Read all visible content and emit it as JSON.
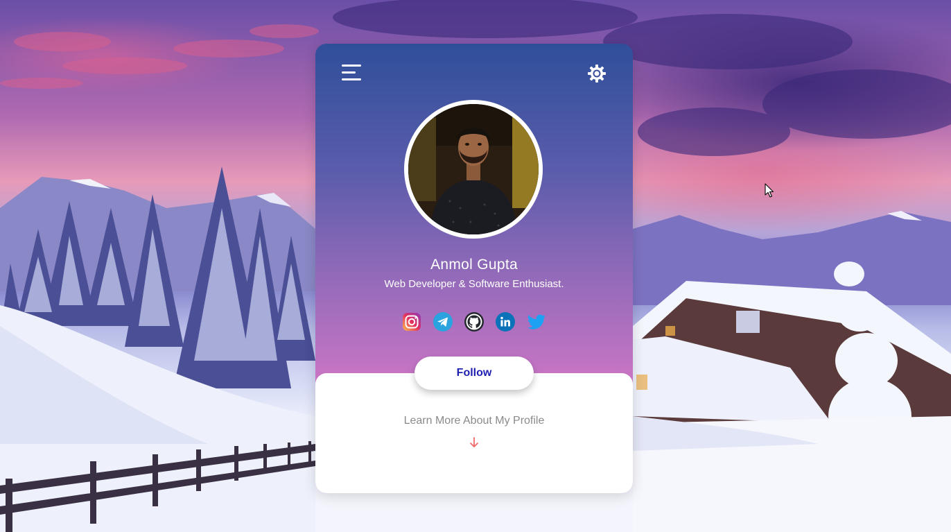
{
  "profile": {
    "name": "Anmol Gupta",
    "tagline": "Web Developer & Software Enthusiast."
  },
  "header": {
    "menu_icon": "hamburger-menu-icon",
    "settings_icon": "gear-icon"
  },
  "socials": [
    {
      "name": "instagram-icon",
      "color": "#e1306c"
    },
    {
      "name": "telegram-icon",
      "color": "#2aa3df"
    },
    {
      "name": "github-icon",
      "color": "#24292e"
    },
    {
      "name": "linkedin-icon",
      "color": "#0a66c2"
    },
    {
      "name": "twitter-icon",
      "color": "#1da1f2"
    }
  ],
  "actions": {
    "follow_label": "Follow",
    "learn_more_label": "Learn More About My Profile",
    "learn_more_icon": "arrow-down-icon"
  },
  "colors": {
    "follow_text": "#1f1fb0",
    "arrow": "#f06a6a",
    "card_top": "#2f4f9a",
    "card_bottom": "#c474c3"
  }
}
